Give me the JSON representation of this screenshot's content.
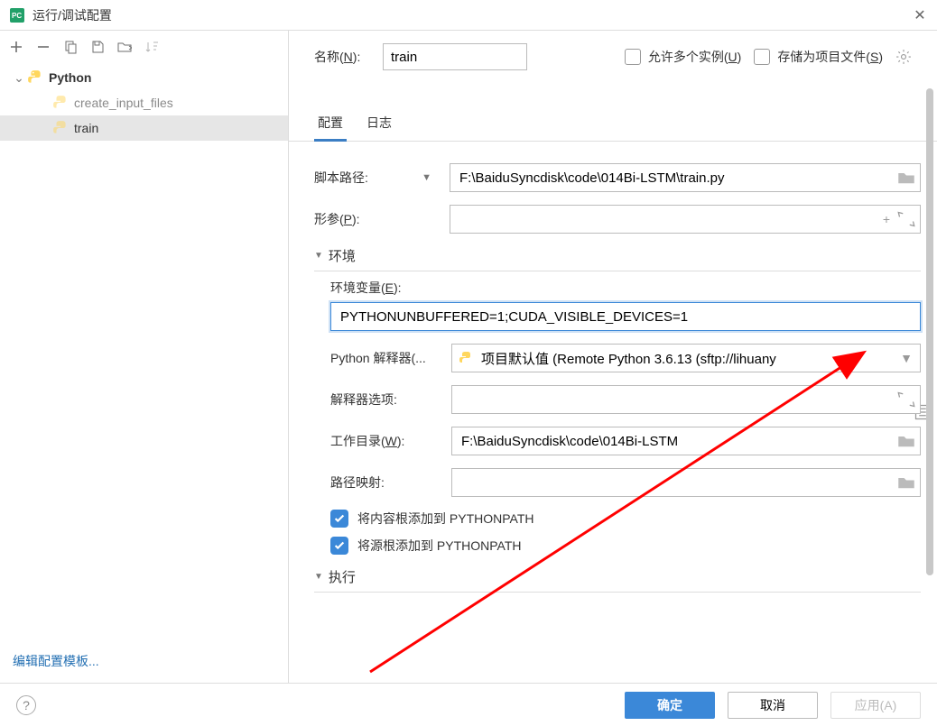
{
  "titlebar": {
    "title": "运行/调试配置"
  },
  "sidebar": {
    "parent": "Python",
    "children": [
      "create_input_files",
      "train"
    ],
    "footer_link": "编辑配置模板..."
  },
  "namerow": {
    "label": "名称(N):",
    "value": "train",
    "allow_multi": "允许多个实例(U)",
    "store_project": "存储为项目文件(S)"
  },
  "tabs": {
    "config": "配置",
    "log": "日志"
  },
  "form": {
    "script_path_label": "脚本路径:",
    "script_path_value": "F:\\BaiduSyncdisk\\code\\014Bi-LSTM\\train.py",
    "args_label": "形参(P):",
    "args_value": "",
    "env_section": "环境",
    "env_vars_label": "环境变量(E):",
    "env_vars_value": "PYTHONUNBUFFERED=1;CUDA_VISIBLE_DEVICES=1",
    "interpreter_label": "Python 解释器(...",
    "interpreter_value": "项目默认值 (Remote Python 3.6.13 (sftp://lihuany",
    "interp_opts_label": "解释器选项:",
    "interp_opts_value": "",
    "workdir_label": "工作目录(W):",
    "workdir_value": "F:\\BaiduSyncdisk\\code\\014Bi-LSTM",
    "pathmap_label": "路径映射:",
    "pathmap_value": "",
    "chk_content_root": "将内容根添加到 PYTHONPATH",
    "chk_source_root": "将源根添加到 PYTHONPATH",
    "exec_section": "执行"
  },
  "footer": {
    "ok": "确定",
    "cancel": "取消",
    "apply": "应用(A)"
  }
}
